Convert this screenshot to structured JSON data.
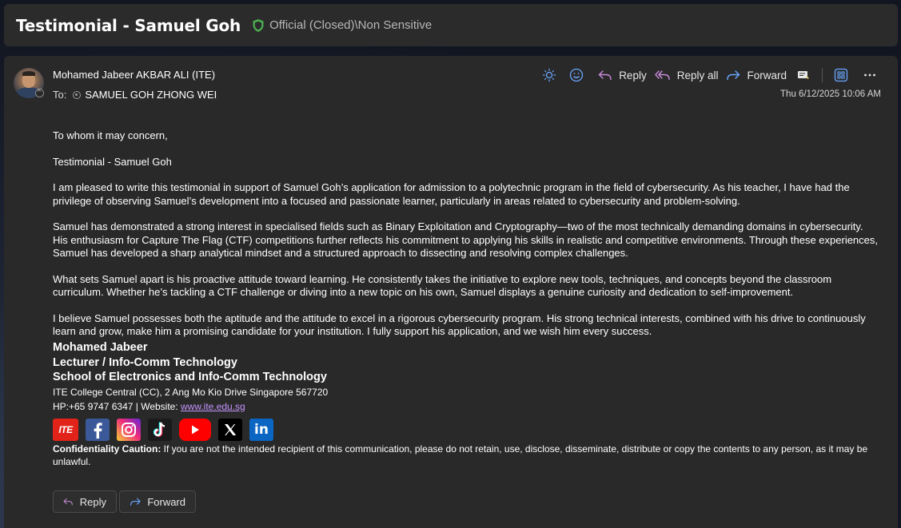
{
  "header": {
    "subject": "Testimonial - Samuel Goh",
    "sensitivity_label": "Official (Closed)\\Non Sensitive",
    "sensitivity_icon": "shield-icon",
    "accent": "#4caf50"
  },
  "message": {
    "sender": "Mohamed Jabeer AKBAR ALI (ITE)",
    "to_label": "To:",
    "recipient": "SAMUEL GOH ZHONG WEI",
    "timestamp": "Thu 6/12/2025 10:06 AM"
  },
  "toolbar": {
    "reply_label": "Reply",
    "reply_all_label": "Reply all",
    "forward_label": "Forward",
    "icons": [
      "brightness-icon",
      "emoji-icon",
      "reply-icon",
      "reply-all-icon",
      "forward-icon",
      "immersive-reader-icon",
      "apps-icon",
      "more-options-icon"
    ]
  },
  "body": {
    "greeting": "To whom it may concern,",
    "title": "Testimonial - Samuel Goh",
    "p1": "I am pleased to write this testimonial in support of Samuel Goh’s application for admission to a polytechnic program in the field of cybersecurity. As his teacher, I have had the privilege of observing Samuel’s development into a focused and passionate learner, particularly in areas related to cybersecurity and problem-solving.",
    "p2": "Samuel has demonstrated a strong interest in specialised fields such as Binary Exploitation and Cryptography—two of the most technically demanding domains in cybersecurity. His enthusiasm for Capture The Flag (CTF) competitions further reflects his commitment to applying his skills in realistic and competitive environments. Through these experiences, Samuel has developed a sharp analytical mindset and a structured approach to dissecting and resolving complex challenges.",
    "p3": "What sets Samuel apart is his proactive attitude toward learning. He consistently takes the initiative to explore new tools, techniques, and concepts beyond the classroom curriculum. Whether he’s tackling a CTF challenge or diving into a new topic on his own, Samuel displays a genuine curiosity and dedication to self-improvement.",
    "p4": "I believe Samuel possesses both the aptitude and the attitude to excel in a rigorous cybersecurity program. His strong technical interests, combined with his drive to continuously learn and grow, make him a promising candidate for your institution.  I fully support his application, and we wish him every success."
  },
  "signature": {
    "name": "Mohamed Jabeer",
    "role": "Lecturer / Info-Comm Technology",
    "school": "School of Electronics and Info-Comm Technology",
    "address": "ITE College Central (CC), 2 Ang Mo Kio Drive Singapore 567720",
    "phone_prefix": "HP:+65 9747 6347 | Website: ",
    "website": "www.ite.edu.sg",
    "social_icons": [
      "ite-logo-icon",
      "facebook-icon",
      "instagram-icon",
      "tiktok-icon",
      "youtube-icon",
      "x-icon",
      "linkedin-icon"
    ],
    "ite_logo_text": "ITE"
  },
  "confidentiality": {
    "label": "Confidentiality Caution:",
    "text": " If you are not the intended recipient of this communication, please do not retain, use, disclose, disseminate, distribute or copy the contents to any person, as it may be unlawful."
  },
  "footer": {
    "reply_label": "Reply",
    "forward_label": "Forward"
  }
}
